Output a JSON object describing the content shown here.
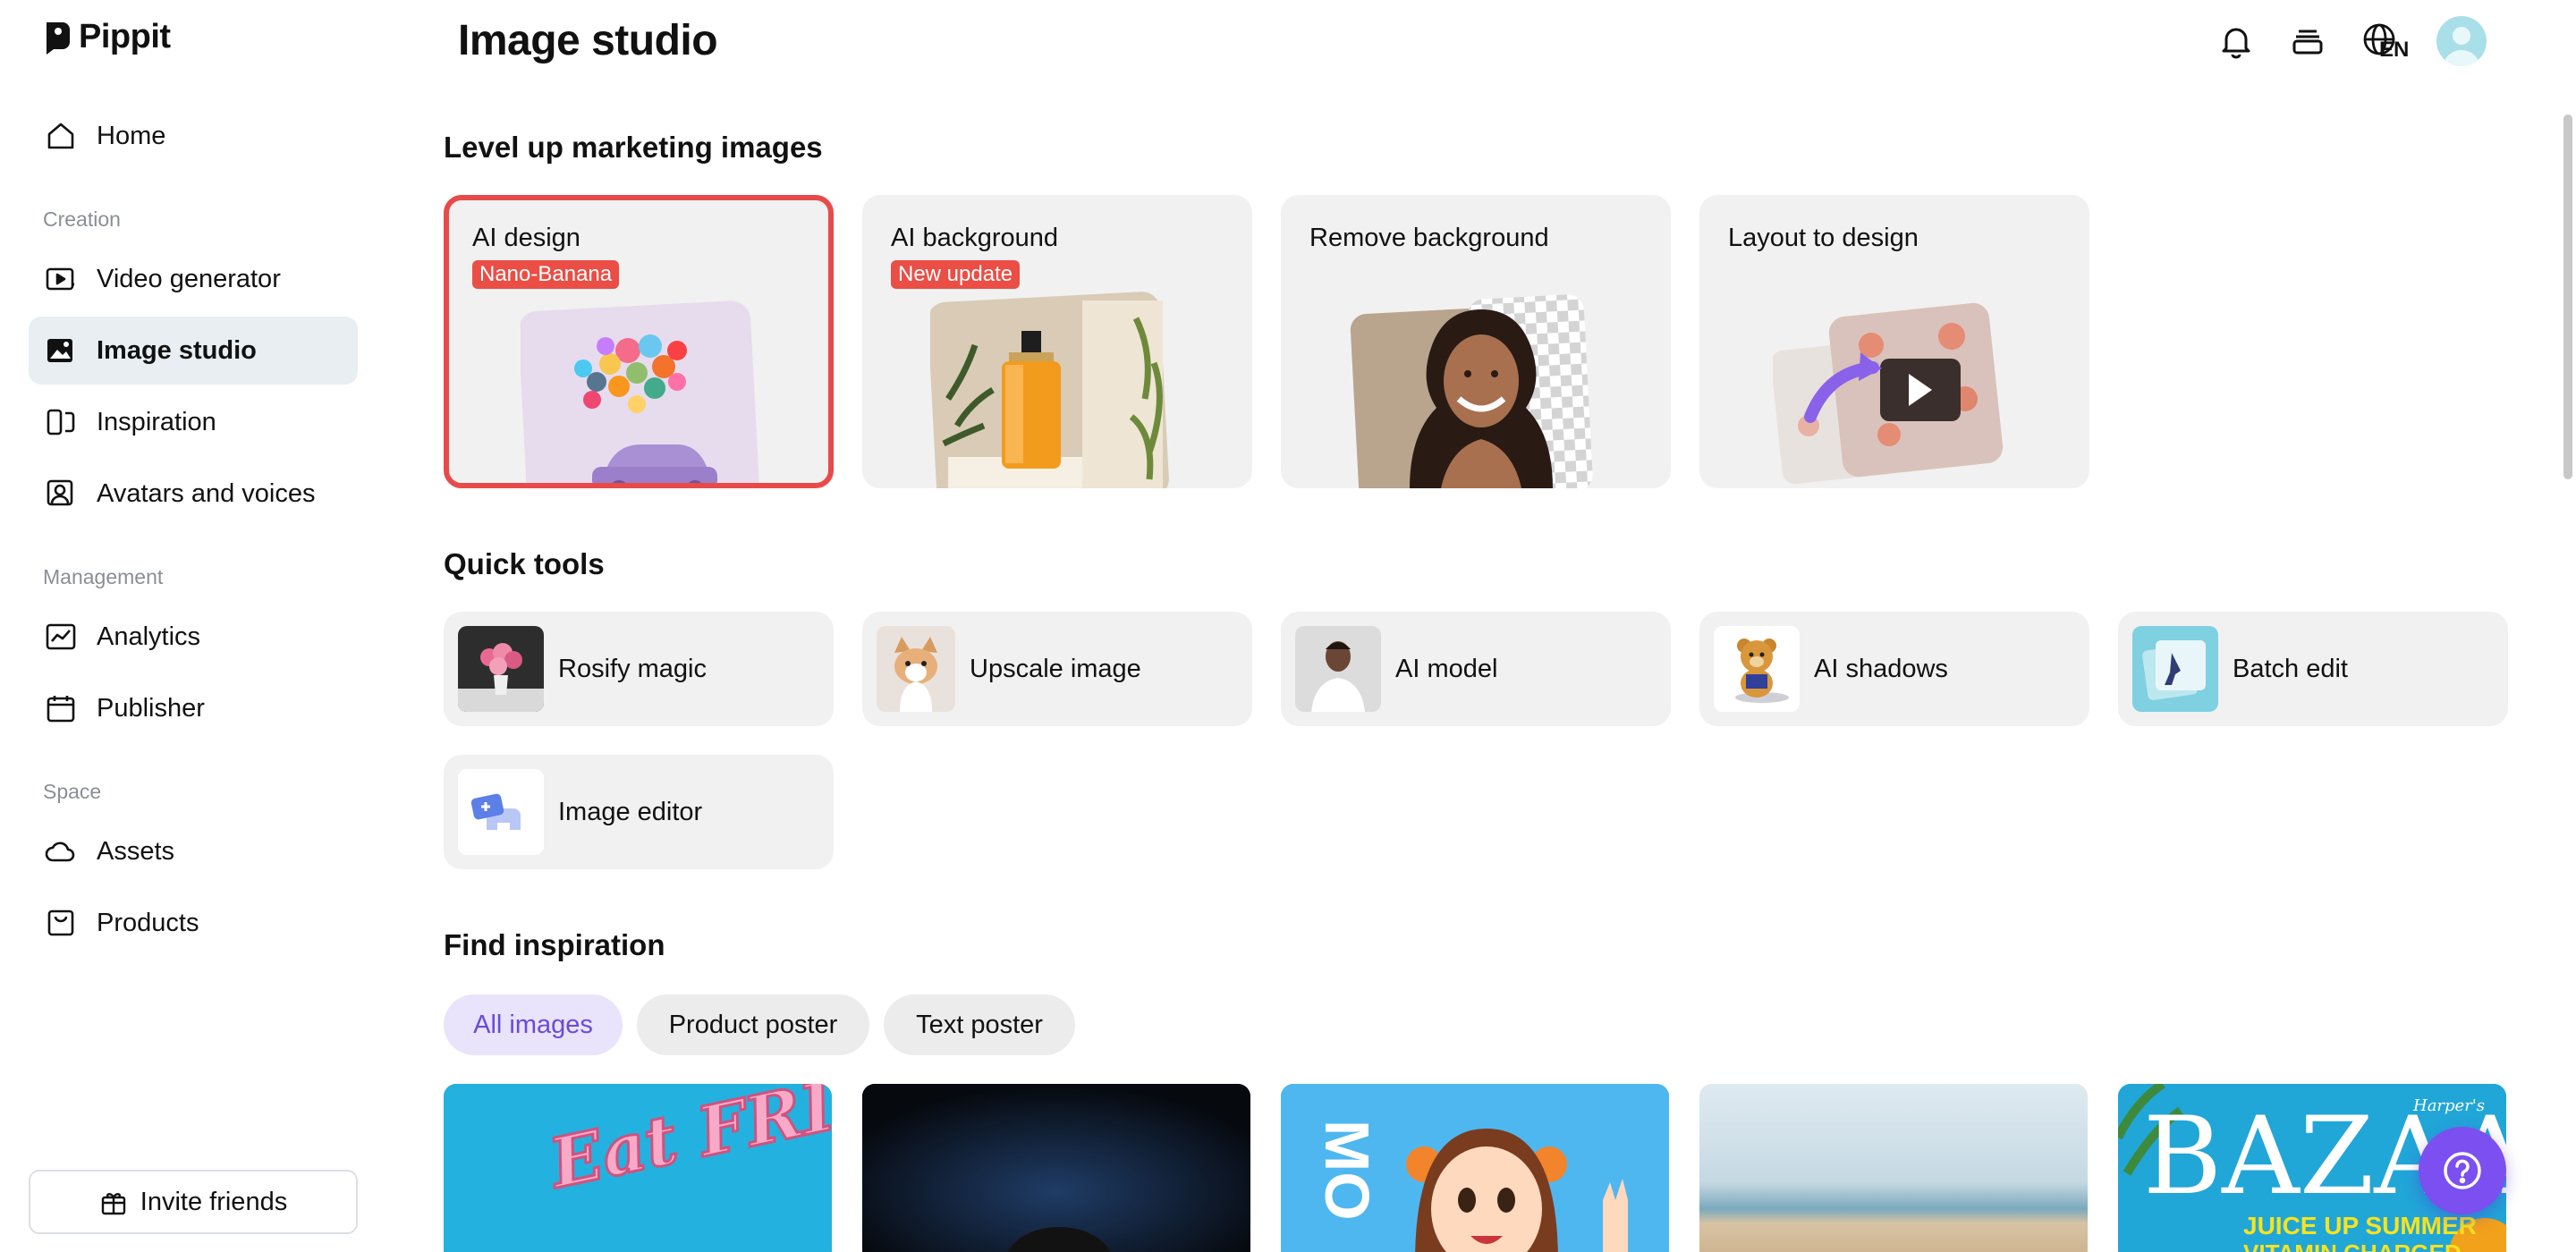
{
  "brand": {
    "name": "Pippit"
  },
  "sidebar": {
    "home": "Home",
    "sections": {
      "creation": "Creation",
      "management": "Management",
      "space": "Space"
    },
    "creation_items": [
      "Video generator",
      "Image studio",
      "Inspiration",
      "Avatars and voices"
    ],
    "management_items": [
      "Analytics",
      "Publisher"
    ],
    "space_items": [
      "Assets",
      "Products"
    ],
    "active_item": "Image studio",
    "invite": "Invite friends"
  },
  "header": {
    "title": "Image studio",
    "language": "EN",
    "icons": [
      "bell-icon",
      "stack-icon",
      "globe-icon",
      "avatar"
    ]
  },
  "marketing": {
    "heading": "Level up marketing images",
    "cards": [
      {
        "title": "AI design",
        "badge": "Nano-Banana"
      },
      {
        "title": "AI background",
        "badge": "New update"
      },
      {
        "title": "Remove background",
        "badge": ""
      },
      {
        "title": "Layout to design",
        "badge": ""
      }
    ]
  },
  "quick_tools": {
    "heading": "Quick tools",
    "items": [
      "Rosify magic",
      "Upscale image",
      "AI model",
      "AI shadows",
      "Batch edit",
      "Image editor"
    ]
  },
  "inspiration": {
    "heading": "Find inspiration",
    "filters": [
      "All images",
      "Product poster",
      "Text poster"
    ],
    "active_filter": "All images",
    "cards": [
      {
        "text": "Eat FRITAS!"
      },
      {
        "text": ""
      },
      {
        "text": "MO"
      },
      {
        "text": ""
      },
      {
        "text": "BAZAAR",
        "sub1": "JUICE UP SUMMER",
        "sub2": "VITAMIN CHARGED",
        "small": "Harper's"
      }
    ]
  },
  "colors": {
    "accent": "#7b4ff0",
    "selected_border": "#e84a4a",
    "badge": "#ea4e45",
    "active_nav": "#e8eef1",
    "chip_active": "#e9e3fb"
  }
}
